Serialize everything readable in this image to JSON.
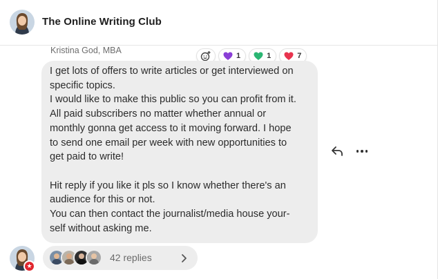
{
  "header": {
    "title": "The Online Writing Club",
    "avatar_icon": "person-avatar"
  },
  "message": {
    "author": "Kristina God, MBA",
    "text": "I get lots of offers to write articles or get interviewed on\nspecific topics.\nI would like to make this public so you can profit from it.\nAll paid subscribers no matter whether annual or\nmonthly gonna get access to it moving forward. I hope\nto send one email per week with new opportunities to\nget paid to write!\n\nHit reply if you like it pls so I know whether there's an\naudience for this or not.\nYou can then contact the journalist/media house your-\nself without asking me.",
    "reactions": [
      {
        "icon": "purple-heart-icon",
        "color": "#8a3fd6",
        "count": "1"
      },
      {
        "icon": "green-heart-icon",
        "color": "#2bb673",
        "count": "1"
      },
      {
        "icon": "red-heart-icon",
        "color": "#e8344e",
        "count": "7"
      }
    ]
  },
  "actions": {
    "reply_icon": "reply-arrow-icon",
    "more_icon": "more-dots-icon"
  },
  "replies": {
    "label": "42 replies",
    "avatars": [
      "avatar-1",
      "avatar-2",
      "avatar-3",
      "avatar-4"
    ]
  },
  "colors": {
    "bubble": "#ededed",
    "badge": "#e0262e"
  }
}
